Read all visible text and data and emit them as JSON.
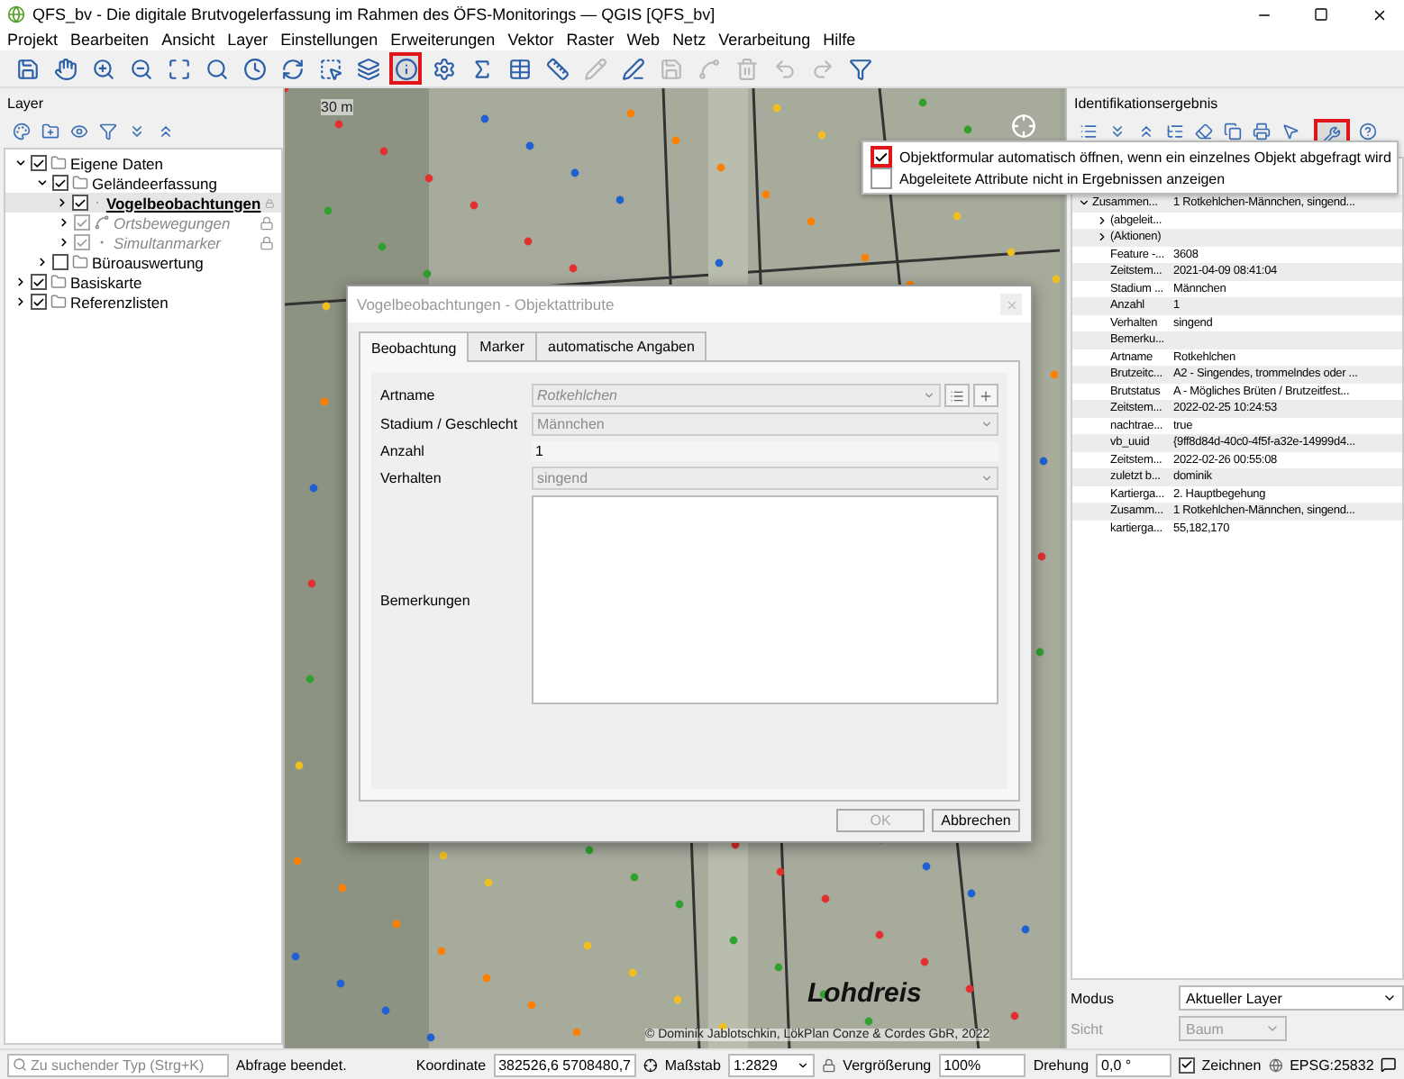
{
  "window": {
    "title": "QFS_bv - Die digitale Brutvogelerfassung im Rahmen des ÖFS-Monitorings — QGIS [QFS_bv]"
  },
  "menu": [
    "Projekt",
    "Bearbeiten",
    "Ansicht",
    "Layer",
    "Einstellungen",
    "Erweiterungen",
    "Vektor",
    "Raster",
    "Web",
    "Netz",
    "Verarbeitung",
    "Hilfe"
  ],
  "toolbar": [
    {
      "kind": "save",
      "highlighted": false,
      "disabled": false
    },
    {
      "kind": "pan",
      "highlighted": false,
      "disabled": false
    },
    {
      "kind": "zoom-in",
      "highlighted": false,
      "disabled": false
    },
    {
      "kind": "zoom-out",
      "highlighted": false,
      "disabled": false
    },
    {
      "kind": "zoom-full",
      "highlighted": false,
      "disabled": false
    },
    {
      "kind": "zoom-layer",
      "highlighted": false,
      "disabled": false
    },
    {
      "kind": "clock",
      "highlighted": false,
      "disabled": false
    },
    {
      "kind": "refresh",
      "highlighted": false,
      "disabled": false
    },
    {
      "kind": "select",
      "highlighted": false,
      "disabled": false
    },
    {
      "kind": "deselect",
      "highlighted": false,
      "disabled": false
    },
    {
      "kind": "identify",
      "highlighted": true,
      "disabled": false
    },
    {
      "kind": "gear",
      "highlighted": false,
      "disabled": false
    },
    {
      "kind": "sigma",
      "highlighted": false,
      "disabled": false
    },
    {
      "kind": "table",
      "highlighted": false,
      "disabled": false
    },
    {
      "kind": "ruler",
      "highlighted": false,
      "disabled": false
    },
    {
      "kind": "pencil",
      "highlighted": false,
      "disabled": true
    },
    {
      "kind": "edit",
      "highlighted": false,
      "disabled": false
    },
    {
      "kind": "save",
      "highlighted": false,
      "disabled": true
    },
    {
      "kind": "nodes",
      "highlighted": false,
      "disabled": true
    },
    {
      "kind": "delete",
      "highlighted": false,
      "disabled": true
    },
    {
      "kind": "undo",
      "highlighted": false,
      "disabled": true
    },
    {
      "kind": "redo",
      "highlighted": false,
      "disabled": true
    },
    {
      "kind": "filter",
      "highlighted": false,
      "disabled": false
    }
  ],
  "layers_panel": {
    "title": "Layer",
    "tree": [
      {
        "label": "Eigene Daten",
        "kind": "group",
        "checked": true,
        "expanded": true,
        "selected": false,
        "disabled": false,
        "locked": false,
        "children": [
          {
            "label": "Geländeerfassung",
            "kind": "group",
            "checked": true,
            "expanded": true,
            "selected": false,
            "disabled": false,
            "locked": false,
            "children": [
              {
                "label": "Vogelbeobachtungen",
                "kind": "point",
                "checked": true,
                "expanded": false,
                "selected": true,
                "disabled": false,
                "locked": true
              },
              {
                "label": "Ortsbewegungen",
                "kind": "line",
                "checked": true,
                "expanded": false,
                "selected": false,
                "disabled": true,
                "locked": true
              },
              {
                "label": "Simultanmarker",
                "kind": "point",
                "checked": true,
                "expanded": false,
                "selected": false,
                "disabled": true,
                "locked": true
              }
            ]
          },
          {
            "label": "Büroauswertung",
            "kind": "group",
            "checked": false,
            "expanded": false,
            "selected": false,
            "disabled": false,
            "locked": false
          }
        ]
      },
      {
        "label": "Basiskarte",
        "kind": "group",
        "checked": true,
        "expanded": false,
        "selected": false,
        "disabled": false,
        "locked": false
      },
      {
        "label": "Referenzlisten",
        "kind": "group",
        "checked": true,
        "expanded": false,
        "selected": false,
        "disabled": false,
        "locked": false
      }
    ]
  },
  "map": {
    "scale_label": "30 m",
    "place_label": "Lohdreis",
    "attribution": "© Dominik Jablotschkin, LökPlan Conze & Cordes GbR, 2022"
  },
  "dialog": {
    "title": "Vogelbeobachtungen - Objektattribute",
    "tabs": [
      {
        "label": "Beobachtung",
        "selected": true
      },
      {
        "label": "Marker",
        "selected": false
      },
      {
        "label": "automatische Angaben",
        "selected": false
      }
    ],
    "fields": [
      {
        "label": "Artname",
        "kind": "lookup",
        "value": "Rotkehlchen",
        "disabled": true
      },
      {
        "label": "Stadium / Geschlecht",
        "kind": "combo",
        "value": "Männchen",
        "disabled": true
      },
      {
        "label": "Anzahl",
        "kind": "text",
        "value": "1",
        "disabled": false
      },
      {
        "label": "Verhalten",
        "kind": "combo",
        "value": "singend",
        "disabled": true
      },
      {
        "label": "Bemerkungen",
        "kind": "textarea"
      }
    ],
    "buttons": [
      {
        "label": "OK",
        "disabled": true
      },
      {
        "label": "Abbrechen",
        "disabled": false
      }
    ]
  },
  "identify_panel": {
    "title": "Identifikationsergebnis",
    "toolbar": [
      {
        "kind": "expand",
        "highlighted": false
      },
      {
        "kind": "expand-all",
        "highlighted": false
      },
      {
        "kind": "collapse-all",
        "highlighted": false
      },
      {
        "kind": "expand-new",
        "highlighted": false
      },
      {
        "kind": "clear",
        "highlighted": false
      },
      {
        "kind": "copy",
        "highlighted": false
      },
      {
        "kind": "print",
        "highlighted": false
      },
      {
        "kind": "select-mode",
        "highlighted": false
      },
      {
        "kind": "settings",
        "highlighted": true
      },
      {
        "kind": "help",
        "highlighted": false
      }
    ],
    "options_menu": [
      {
        "label": "Objektformular automatisch öffnen, wenn ein einzelnes Objekt abgefragt wird",
        "checked": true,
        "highlighted": true
      },
      {
        "label": "Abgeleitete Attribute nicht in Ergebnissen anzeigen",
        "checked": false,
        "highlighted": false
      }
    ],
    "rows": [
      {
        "kind": "feature",
        "label": "Zusammen...",
        "value": "1 Rotkehlchen-Männchen, singend...",
        "expanded": true,
        "children": [
          {
            "kind": "group",
            "label": "(abgeleit...",
            "expanded": false
          },
          {
            "kind": "group",
            "label": "(Aktionen)",
            "expanded": false
          },
          {
            "kind": "attribute",
            "label": "Feature -...",
            "value": "3608"
          },
          {
            "kind": "attribute",
            "label": "Zeitstem...",
            "value": "2021-04-09 08:41:04"
          },
          {
            "kind": "attribute",
            "label": "Stadium ...",
            "value": "Männchen"
          },
          {
            "kind": "attribute",
            "label": "Anzahl",
            "value": "1"
          },
          {
            "kind": "attribute",
            "label": "Verhalten",
            "value": "singend"
          },
          {
            "kind": "attribute",
            "label": "Bemerku..."
          },
          {
            "kind": "attribute",
            "label": "Artname",
            "value": "Rotkehlchen"
          },
          {
            "kind": "attribute",
            "label": "Brutzeitc...",
            "value": "A2 - Singendes, trommelndes oder ..."
          },
          {
            "kind": "attribute",
            "label": "Brutstatus",
            "value": "A - Mögliches Brüten / Brutzeitfest..."
          },
          {
            "kind": "attribute",
            "label": "Zeitstem...",
            "value": "2022-02-25 10:24:53"
          },
          {
            "kind": "attribute",
            "label": "nachtrae...",
            "value": "true"
          },
          {
            "kind": "attribute",
            "label": "vb_uuid",
            "value": "{9ff8d84d-40c0-4f5f-a32e-14999d4..."
          },
          {
            "kind": "attribute",
            "label": "Zeitstem...",
            "value": "2022-02-26 00:55:08"
          },
          {
            "kind": "attribute",
            "label": "zuletzt b...",
            "value": "dominik"
          },
          {
            "kind": "attribute",
            "label": "Kartierga...",
            "value": "2. Hauptbegehung"
          },
          {
            "kind": "attribute",
            "label": "Zusamm...",
            "value": "1 Rotkehlchen-Männchen, singend..."
          },
          {
            "kind": "attribute",
            "label": "kartierga...",
            "value": "55,182,170"
          }
        ]
      }
    ],
    "mode": {
      "label": "Modus",
      "value": "Aktueller Layer"
    },
    "view": {
      "label": "Sicht",
      "value": "Baum",
      "disabled": true
    }
  },
  "status_bar": {
    "search_placeholder": "Zu suchender Typ (Strg+K)",
    "message": "Abfrage beendet.",
    "coordinate_label": "Koordinate",
    "coordinate": "382526,6 5708480,7",
    "scale_label": "Maßstab",
    "scale": "1:2829",
    "magnifier_label": "Vergrößerung",
    "magnifier": "100%",
    "rotation_label": "Drehung",
    "rotation": "0,0 °",
    "render_label": "Zeichnen",
    "render": true,
    "crs": "EPSG:25832"
  }
}
